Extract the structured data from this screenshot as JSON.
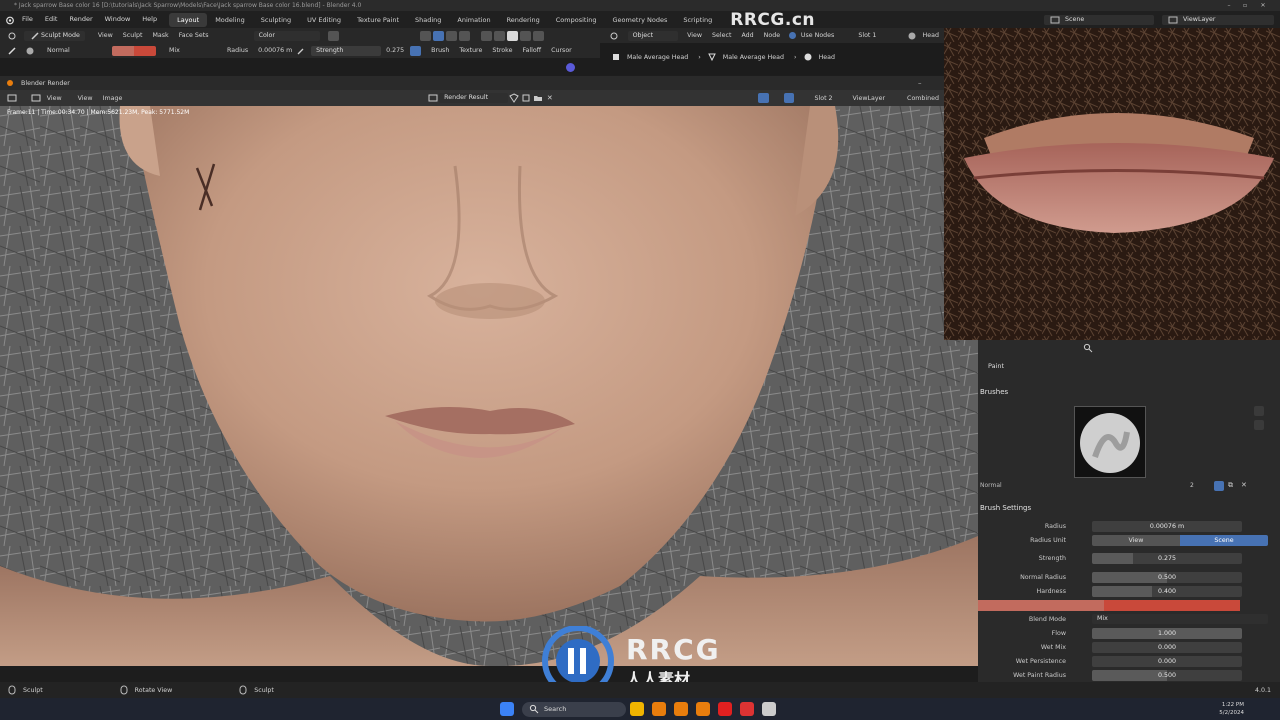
{
  "titlebar": {
    "text": "* Jack sparrow Base color 16 [D:\\tutorials\\Jack Sparrow\\Models\\Face\\Jack sparrow Base color 16.blend] - Blender 4.0"
  },
  "menu": [
    "File",
    "Edit",
    "Render",
    "Window",
    "Help"
  ],
  "workspaces": [
    "Layout",
    "Modeling",
    "Sculpting",
    "UV Editing",
    "Texture Paint",
    "Shading",
    "Animation",
    "Rendering",
    "Compositing",
    "Geometry Nodes",
    "Scripting"
  ],
  "active_workspace": "Layout",
  "scene": {
    "scene_label": "Scene",
    "viewlayer_label": "ViewLayer"
  },
  "toolheader": {
    "mode": "Sculpt Mode",
    "items": [
      "View",
      "Sculpt",
      "Mask",
      "Face Sets"
    ],
    "color_mode": "Color"
  },
  "brushheader": {
    "brush_name": "Normal",
    "blend": "Mix",
    "radius_label": "Radius",
    "radius_value": "0.00076 m",
    "strength_label": "Strength",
    "strength_value": "0.275",
    "menus": [
      "Brush",
      "Texture",
      "Stroke",
      "Falloff",
      "Cursor"
    ]
  },
  "nodeheader": {
    "object": "Object",
    "items": [
      "View",
      "Select",
      "Add",
      "Node"
    ],
    "use_nodes": "Use Nodes",
    "slot": "Slot 1",
    "material": "Head"
  },
  "breadcrumb": [
    "Male Average Head",
    "Male Average Head",
    "Head"
  ],
  "renderwin": {
    "title": "Blender Render",
    "menus": [
      "View",
      "View",
      "Image"
    ],
    "image_name": "Render Result",
    "slot": "Slot 2",
    "viewlayer": "ViewLayer",
    "pass": "Combined",
    "stats": "Frame:11 | Time:00:34.70 | Mem:5621.23M, Peak: 5771.52M"
  },
  "props": {
    "mode_label": "Paint",
    "brushes_title": "Brushes",
    "brush_name": "Normal",
    "brush_users": "2",
    "settings_title": "Brush Settings",
    "radius_label": "Radius",
    "radius_value": "0.00076 m",
    "radius_unit_label": "Radius Unit",
    "unit_view": "View",
    "unit_scene": "Scene",
    "strength_label": "Strength",
    "strength_value": "0.275",
    "strength_frac": 0.275,
    "normal_radius_label": "Normal Radius",
    "normal_radius_value": "0.500",
    "normal_radius_frac": 0.5,
    "hardness_label": "Hardness",
    "hardness_value": "0.400",
    "hardness_frac": 0.4,
    "blend_label": "Blend Mode",
    "blend_value": "Mix",
    "flow_label": "Flow",
    "flow_value": "1.000",
    "flow_frac": 1.0,
    "wet_mix_label": "Wet Mix",
    "wet_mix_value": "0.000",
    "wet_mix_frac": 0.0,
    "wet_persistence_label": "Wet Persistence",
    "wet_persistence_value": "0.000",
    "wet_persistence_frac": 0.0,
    "wet_paint_radius_label": "Wet Paint Radius",
    "wet_paint_radius_value": "0.500",
    "wet_paint_radius_frac": 0.5,
    "color_primary": "#c26b5e",
    "color_secondary": "#c9493a"
  },
  "statusbar": {
    "left": "Sculpt",
    "middle": "Rotate View",
    "right": "Sculpt",
    "version": "4.0.1"
  },
  "taskbar": {
    "search": "Search",
    "time": "1:22 PM",
    "date": "5/2/2024"
  },
  "watermark": {
    "top": "RRCG.cn",
    "brand": "RRCG",
    "sub": "人人素材"
  },
  "colors": {
    "accent": "#4772b3",
    "skin": "#c8a08a"
  }
}
